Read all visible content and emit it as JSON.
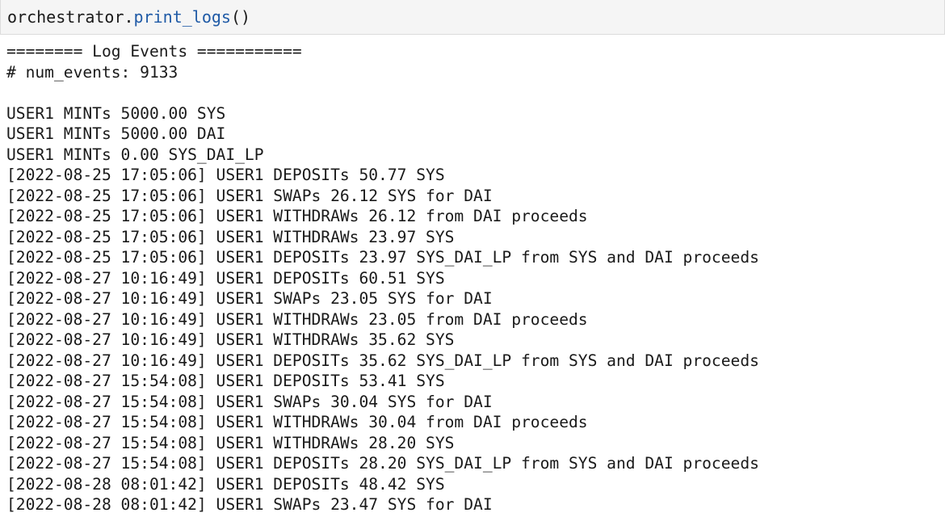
{
  "cell": {
    "code_object": "orchestrator.",
    "code_function": "print_logs",
    "code_call": "()"
  },
  "output": {
    "lines": [
      "======== Log Events ===========",
      "# num_events: 9133",
      "",
      "USER1 MINTs 5000.00 SYS",
      "USER1 MINTs 5000.00 DAI",
      "USER1 MINTs 0.00 SYS_DAI_LP",
      "[2022-08-25 17:05:06] USER1 DEPOSITs 50.77 SYS",
      "[2022-08-25 17:05:06] USER1 SWAPs 26.12 SYS for DAI",
      "[2022-08-25 17:05:06] USER1 WITHDRAWs 26.12 from DAI proceeds",
      "[2022-08-25 17:05:06] USER1 WITHDRAWs 23.97 SYS",
      "[2022-08-25 17:05:06] USER1 DEPOSITs 23.97 SYS_DAI_LP from SYS and DAI proceeds",
      "[2022-08-27 10:16:49] USER1 DEPOSITs 60.51 SYS",
      "[2022-08-27 10:16:49] USER1 SWAPs 23.05 SYS for DAI",
      "[2022-08-27 10:16:49] USER1 WITHDRAWs 23.05 from DAI proceeds",
      "[2022-08-27 10:16:49] USER1 WITHDRAWs 35.62 SYS",
      "[2022-08-27 10:16:49] USER1 DEPOSITs 35.62 SYS_DAI_LP from SYS and DAI proceeds",
      "[2022-08-27 15:54:08] USER1 DEPOSITs 53.41 SYS",
      "[2022-08-27 15:54:08] USER1 SWAPs 30.04 SYS for DAI",
      "[2022-08-27 15:54:08] USER1 WITHDRAWs 30.04 from DAI proceeds",
      "[2022-08-27 15:54:08] USER1 WITHDRAWs 28.20 SYS",
      "[2022-08-27 15:54:08] USER1 DEPOSITs 28.20 SYS_DAI_LP from SYS and DAI proceeds",
      "[2022-08-28 08:01:42] USER1 DEPOSITs 48.42 SYS",
      "[2022-08-28 08:01:42] USER1 SWAPs 23.47 SYS for DAI"
    ]
  },
  "colors": {
    "input_background": "#f5f5f5",
    "input_border": "#dcdcdc",
    "function_name": "#1f5aa6",
    "text": "#1a1a1a"
  }
}
